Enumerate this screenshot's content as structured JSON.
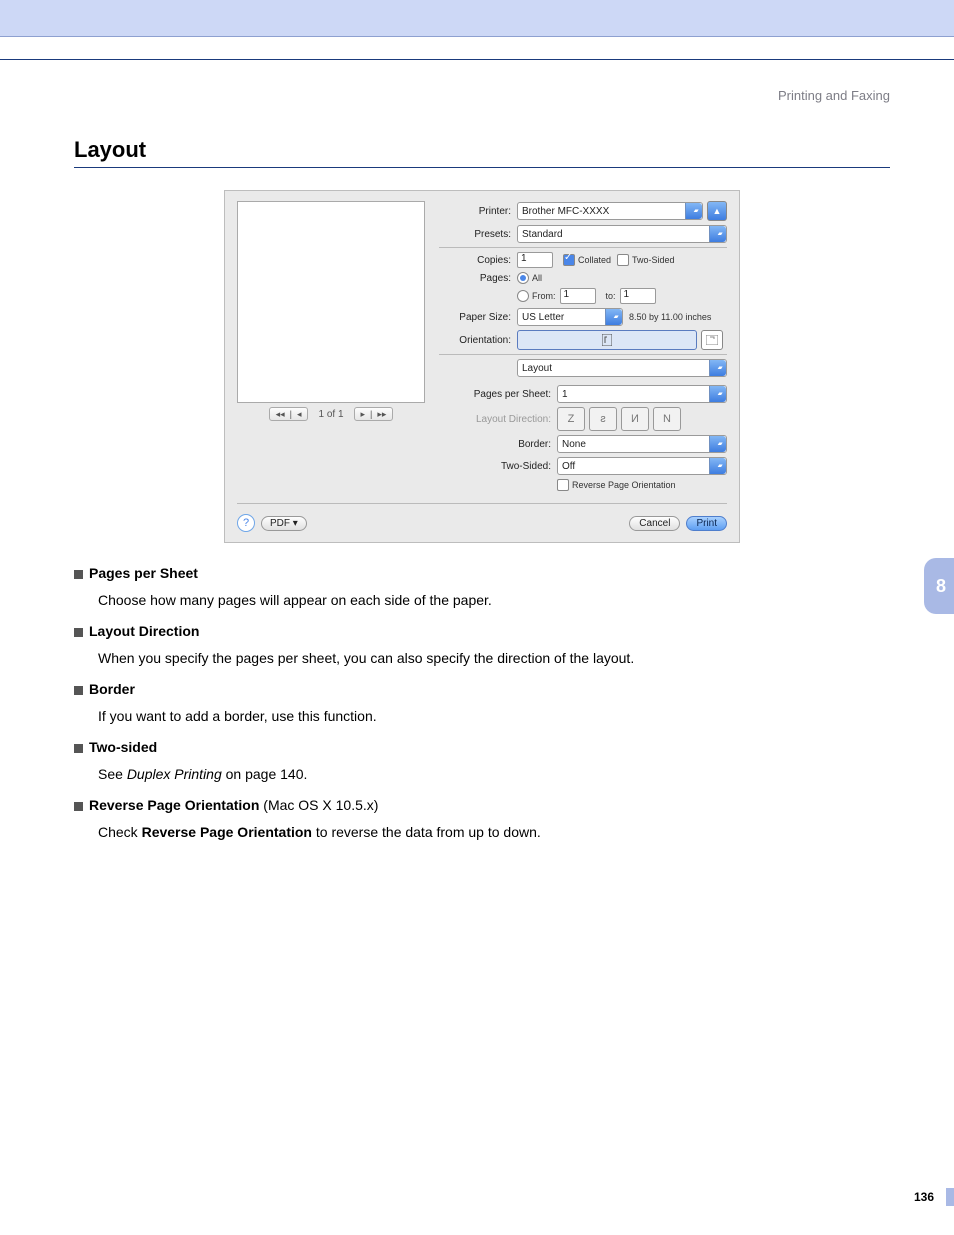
{
  "header": {
    "section": "Printing and Faxing"
  },
  "heading": "Layout",
  "sideTab": "8",
  "pageNumber": "136",
  "dialog": {
    "printer": {
      "label": "Printer:",
      "value": "Brother MFC-XXXX"
    },
    "presets": {
      "label": "Presets:",
      "value": "Standard"
    },
    "copies": {
      "label": "Copies:",
      "value": "1",
      "collated": {
        "label": "Collated",
        "checked": true
      },
      "twoSided": {
        "label": "Two-Sided",
        "checked": false
      }
    },
    "pages": {
      "label": "Pages:",
      "all": "All",
      "fromLabel": "From:",
      "fromValue": "1",
      "toLabel": "to:",
      "toValue": "1"
    },
    "paperSize": {
      "label": "Paper Size:",
      "value": "US Letter",
      "note": "8.50 by 11.00 inches"
    },
    "orientation": {
      "label": "Orientation:"
    },
    "panel": {
      "value": "Layout"
    },
    "pagesPerSheet": {
      "label": "Pages per Sheet:",
      "value": "1"
    },
    "layoutDirection": {
      "label": "Layout Direction:"
    },
    "border": {
      "label": "Border:",
      "value": "None"
    },
    "twoSidedSel": {
      "label": "Two-Sided:",
      "value": "Off"
    },
    "reverse": {
      "label": "Reverse Page Orientation",
      "checked": false
    },
    "pager": {
      "text": "1 of 1"
    },
    "help": "?",
    "pdf": "PDF ▾",
    "cancel": "Cancel",
    "print": "Print",
    "expand": "▲"
  },
  "desc": {
    "pps": {
      "title": "Pages per Sheet",
      "text": "Choose how many pages will appear on each side of the paper."
    },
    "ld": {
      "title": "Layout Direction",
      "text": "When you specify the pages per sheet, you can also specify the direction of the layout."
    },
    "bd": {
      "title": "Border",
      "text": "If you want to add a border, use this function."
    },
    "ts": {
      "title": "Two-sided",
      "pre": "See ",
      "it": "Duplex Printing",
      "post": " on page 140."
    },
    "rp": {
      "title": "Reverse Page Orientation",
      "os": " (Mac OS X 10.5.x)",
      "pre": "Check ",
      "bold": "Reverse Page Orientation",
      "post": " to reverse the data from up to down."
    }
  }
}
